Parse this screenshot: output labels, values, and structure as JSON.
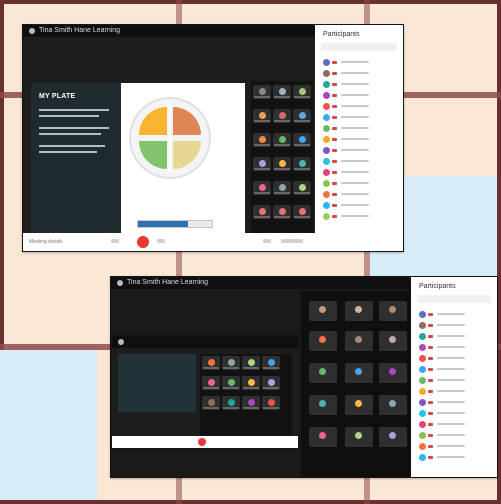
{
  "top_window": {
    "title": "Tina Smith Hane Learning",
    "participants_header": "Participants",
    "slide": {
      "heading": "MY PLATE",
      "body_lines": 6
    },
    "bottom_controls": {
      "left_label": "Meeting details",
      "end_call": "End"
    }
  },
  "bottom_window": {
    "title": "Tina Smith Hane Learning",
    "participants_header": "Participants"
  },
  "colors": {
    "frame": "#6b2f2f",
    "accent_red": "#e53935",
    "accent_blue": "#2f6fb7"
  }
}
